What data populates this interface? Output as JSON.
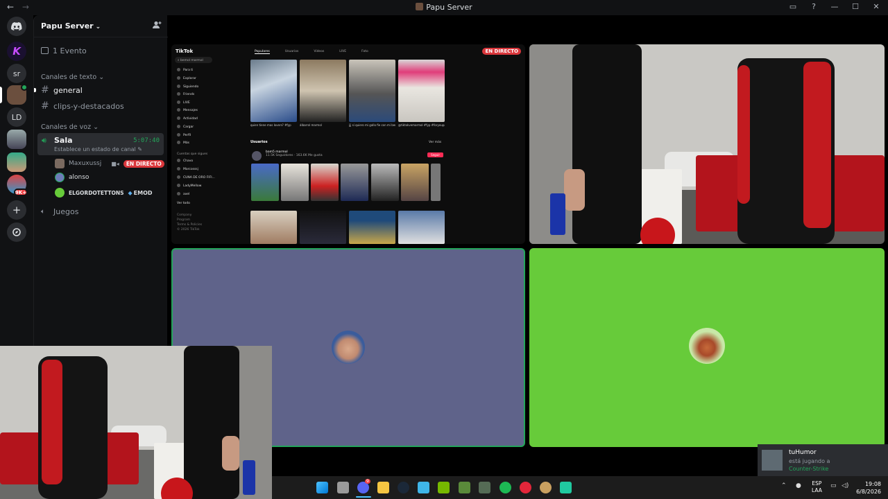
{
  "window": {
    "title": "Papu Server",
    "nav_back": "←",
    "nav_forward": "→",
    "controls": [
      "▭",
      "?",
      "—",
      "☐",
      "✕"
    ]
  },
  "servers": [
    {
      "name": "Discord",
      "icon": "discord-logo-icon"
    },
    {
      "name": "K",
      "icon": "k-server-icon"
    },
    {
      "name": "sr"
    },
    {
      "name": "Papu Server",
      "active": true
    },
    {
      "name": "LD"
    },
    {
      "name": "server-6"
    },
    {
      "name": "server-7"
    },
    {
      "name": "server-8",
      "badge": "9K+"
    },
    {
      "name": "Add a server",
      "icon": "plus-icon"
    },
    {
      "name": "Explore",
      "icon": "compass-icon"
    }
  ],
  "sidebar": {
    "server_name": "Papu Server",
    "events_label": "1 Evento",
    "text_category": "Canales de texto",
    "text_channels": [
      "general",
      "clips-y-destacados"
    ],
    "voice_category": "Canales de voz",
    "voice_channel": {
      "name": "Sala",
      "timer": "5:07:40",
      "status": "Establece un estado de canal"
    },
    "voice_users": [
      {
        "name": "Maxuxussj",
        "live": "EN DIRECTO"
      },
      {
        "name": "alonso"
      },
      {
        "name": "ELGORDOTETTONS",
        "tag": "EMOD"
      }
    ],
    "other_voice": "Juegos"
  },
  "stream": {
    "live_label": "EN DIRECTO",
    "tiktok": {
      "logo": "TikTok",
      "search": "bemol marmol",
      "menu": [
        "Para ti",
        "Explorar",
        "Siguiendo",
        "Friends",
        "LIVE",
        "Mensajes",
        "Actividad",
        "Cargar",
        "Perfil",
        "Más"
      ],
      "tabs": [
        "Populares",
        "Usuarios",
        "Videos",
        "LIVE",
        "Foto"
      ],
      "section_users": "Usuarios",
      "user_name": "bam5 marmol",
      "user_stats": "11.5K Seguidores · 163.6K Me gusta",
      "follow": "Seguir",
      "see_more": "Ver más",
      "following_title": "Cuentas que sigues",
      "following": [
        "Chavo",
        "Marcosssj",
        "CUNA DE ORO FIFI...",
        "LadyMellow",
        "axel"
      ],
      "see_all": "Ver todo",
      "footer": [
        "Company",
        "Program",
        "Terms & Policies",
        "© 2026 TikTok"
      ],
      "captions": [
        "quien tiene mas lovers? #fyp",
        "álbarrol marmol",
        "jjj si quiero mi gallo fie con mi bemol",
        "@tiktokvemarmol #fyp #foryoupage"
      ]
    }
  },
  "toast": {
    "user": "tuHumor",
    "activity": "está jugando a",
    "game": "Counter-Strike"
  },
  "taskbar": {
    "lang_top": "ESP",
    "lang_bottom": "LAA",
    "time": "19:08",
    "date": "6/8/2026",
    "discord_badge": "9"
  },
  "colors": {
    "accent_green": "#23a55a",
    "live_red": "#da373c",
    "purple_tile": "#5f638a",
    "green_tile": "#67cb3a"
  }
}
